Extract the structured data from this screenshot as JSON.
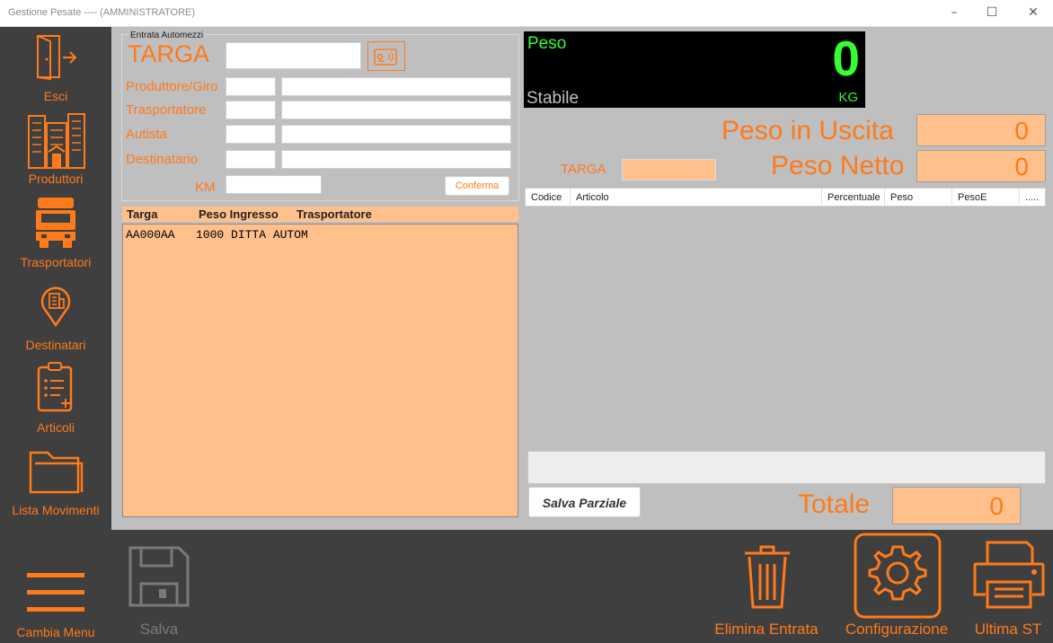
{
  "window": {
    "title": "Gestione Pesate ---- (AMMINISTRATORE)",
    "min_icon": "minimize-icon",
    "max_icon": "maximize-icon",
    "close_icon": "close-icon"
  },
  "sidebar": {
    "items": [
      {
        "label": "Esci",
        "icon": "exit-door-icon"
      },
      {
        "label": "Produttori",
        "icon": "building-icon"
      },
      {
        "label": "Trasportatori",
        "icon": "truck-icon"
      },
      {
        "label": "Destinatari",
        "icon": "location-pin-icon"
      },
      {
        "label": "Articoli",
        "icon": "checklist-icon"
      },
      {
        "label": "Lista Movimenti",
        "icon": "folder-icon"
      }
    ],
    "menu": {
      "label": "Cambia Menu",
      "icon": "hamburger-menu-icon"
    }
  },
  "entry_form": {
    "group_title": "Entrata Automezzi",
    "targa_label": "TARGA",
    "targa_value": "",
    "card_reader_icon": "rfid-card-icon",
    "produttore_label": "Produttore/Giro",
    "trasportatore_label": "Trasportatore",
    "autista_label": "Autista",
    "destinatario_label": "Destinatario",
    "km_label": "KM",
    "km_value": "",
    "confirm_label": "Conferma"
  },
  "entries_list": {
    "headers": [
      "Targa",
      "Peso Ingresso",
      "Trasportatore"
    ],
    "rows": [
      "AA000AA   1000 DITTA AUTOM"
    ]
  },
  "scale": {
    "label": "Peso",
    "value": "0",
    "status": "Stabile",
    "unit": "KG"
  },
  "exit": {
    "peso_uscita_label": "Peso in  Uscita",
    "peso_uscita_value": "0",
    "targa_label": "TARGA",
    "targa_value": "",
    "peso_netto_label": "Peso Netto",
    "peso_netto_value": "0"
  },
  "grid": {
    "columns": [
      "Codice",
      "Articolo",
      "Percentuale",
      "Peso",
      "PesoE",
      "....."
    ]
  },
  "salva_parziale_label": "Salva Parziale",
  "totale": {
    "label": "Totale",
    "value": "0"
  },
  "toolbar": {
    "salva_label": "Salva",
    "elimina_label": "Elimina Entrata",
    "config_label": "Configurazione",
    "ultima_label": "Ultima ST"
  },
  "colors": {
    "accent": "#ff7a1a",
    "panel_dark": "#3f3f3f",
    "field_peach": "#ffc08c",
    "display_green": "#33ff33"
  }
}
